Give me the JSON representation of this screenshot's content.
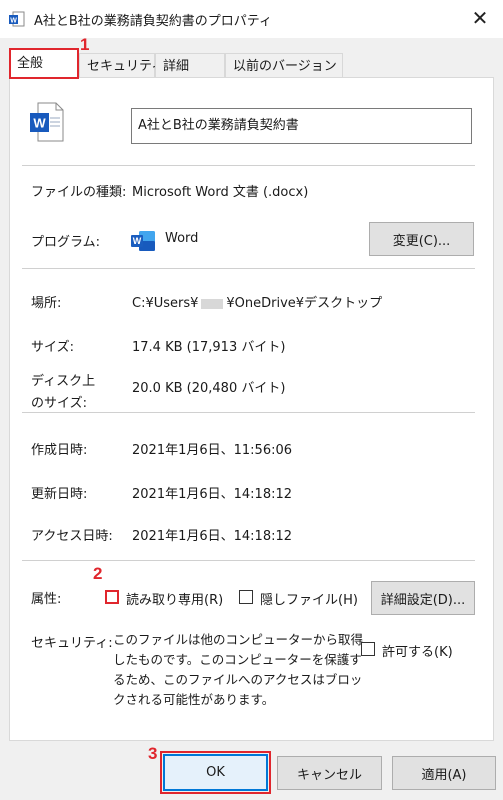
{
  "window": {
    "title": "A社とB社の業務請負契約書のプロパティ",
    "close_glyph": "✕"
  },
  "tabs": [
    {
      "label": "全般"
    },
    {
      "label": "セキュリティ"
    },
    {
      "label": "詳細"
    },
    {
      "label": "以前のバージョン"
    }
  ],
  "file": {
    "name": "A社とB社の業務請負契約書",
    "icon": "word-document-icon"
  },
  "type_row": {
    "label": "ファイルの種類:",
    "value": "Microsoft Word 文書 (.docx)"
  },
  "program_row": {
    "label": "プログラム:",
    "value": "Word",
    "change_button": "変更(C)..."
  },
  "location_row": {
    "label": "場所:",
    "value_prefix": "C:¥Users¥",
    "value_suffix": "¥OneDrive¥デスクトップ"
  },
  "size_row": {
    "label": "サイズ:",
    "value": "17.4 KB (17,913 バイト)"
  },
  "disk_size_row": {
    "label_line1": "ディスク上",
    "label_line2": "のサイズ:",
    "value": "20.0 KB (20,480 バイト)"
  },
  "created_row": {
    "label": "作成日時:",
    "value": "2021年1月6日、11:56:06"
  },
  "modified_row": {
    "label": "更新日時:",
    "value": "2021年1月6日、14:18:12"
  },
  "accessed_row": {
    "label": "アクセス日時:",
    "value": "2021年1月6日、14:18:12"
  },
  "attributes": {
    "label": "属性:",
    "readonly_label": "読み取り専用(R)",
    "readonly_checked": false,
    "hidden_label": "隠しファイル(H)",
    "hidden_checked": false,
    "advanced_button": "詳細設定(D)..."
  },
  "security": {
    "label": "セキュリティ:",
    "message": "このファイルは他のコンピューターから取得したものです。このコンピューターを保護するため、このファイルへのアクセスはブロックされる可能性があります。",
    "allow_label": "許可する(K)",
    "allow_checked": false
  },
  "footer": {
    "ok": "OK",
    "cancel": "キャンセル",
    "apply": "適用(A)"
  },
  "annotations": {
    "n1": "1",
    "n2": "2",
    "n3": "3",
    "color": "#e0262d"
  },
  "colors": {
    "word_blue": "#185abd",
    "panel_bg": "#ffffff",
    "dialog_bg": "#f0f0f0",
    "ok_border": "#0078d7"
  }
}
